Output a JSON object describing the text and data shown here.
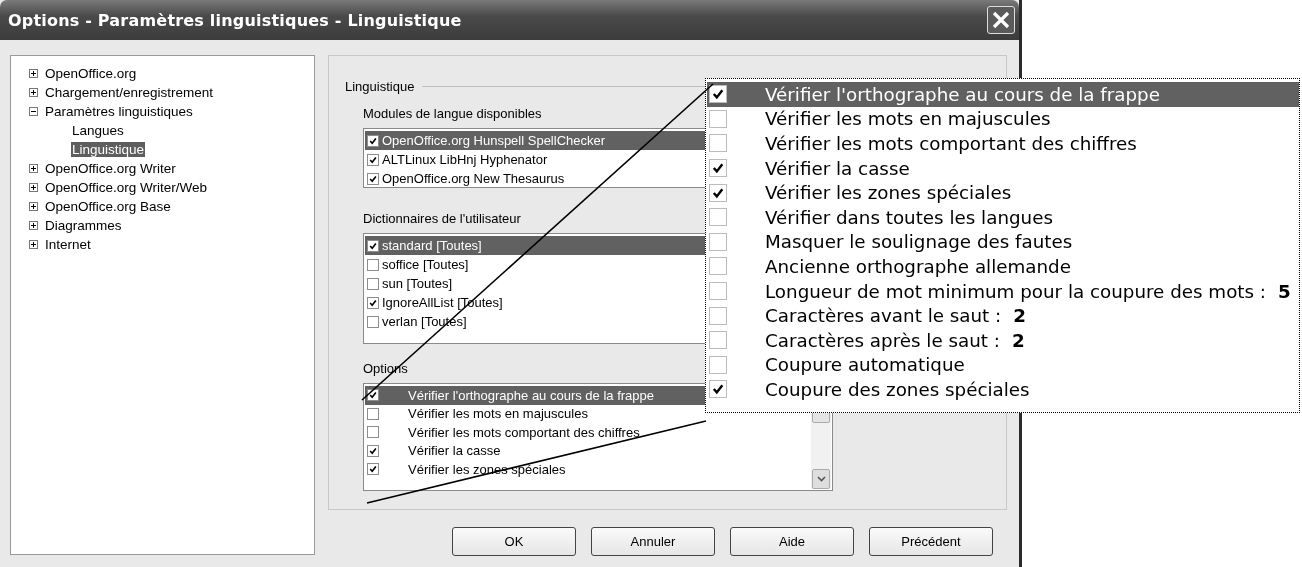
{
  "window": {
    "title": "Options - Paramètres linguistiques - Linguistique"
  },
  "tree": [
    {
      "label": "OpenOffice.org",
      "expanded": false,
      "selected": false
    },
    {
      "label": "Chargement/enregistrement",
      "expanded": false,
      "selected": false
    },
    {
      "label": "Paramètres linguistiques",
      "expanded": true,
      "selected": false,
      "children": [
        {
          "label": "Langues",
          "selected": false
        },
        {
          "label": "Linguistique",
          "selected": true
        }
      ]
    },
    {
      "label": "OpenOffice.org Writer",
      "expanded": false,
      "selected": false
    },
    {
      "label": "OpenOffice.org Writer/Web",
      "expanded": false,
      "selected": false
    },
    {
      "label": "OpenOffice.org Base",
      "expanded": false,
      "selected": false
    },
    {
      "label": "Diagrammes",
      "expanded": false,
      "selected": false
    },
    {
      "label": "Internet",
      "expanded": false,
      "selected": false
    }
  ],
  "section": {
    "title": "Linguistique"
  },
  "modules": {
    "label": "Modules de langue disponibles",
    "items": [
      {
        "label": "OpenOffice.org Hunspell SpellChecker",
        "checked": true,
        "selected": true
      },
      {
        "label": "ALTLinux LibHnj Hyphenator",
        "checked": true,
        "selected": false
      },
      {
        "label": "OpenOffice.org New Thesaurus",
        "checked": true,
        "selected": false
      }
    ]
  },
  "dictionaries": {
    "label": "Dictionnaires de l'utilisateur",
    "items": [
      {
        "label": "standard [Toutes]",
        "checked": true,
        "selected": true
      },
      {
        "label": "soffice [Toutes]",
        "checked": false,
        "selected": false
      },
      {
        "label": "sun [Toutes]",
        "checked": false,
        "selected": false
      },
      {
        "label": "IgnoreAllList [Toutes]",
        "checked": true,
        "selected": false
      },
      {
        "label": "verlan [Toutes]",
        "checked": false,
        "selected": false
      }
    ]
  },
  "options": {
    "label": "Options",
    "items": [
      {
        "label": "Vérifier l'orthographe au cours de la frappe",
        "checked": true,
        "selected": true
      },
      {
        "label": "Vérifier les mots en majuscules",
        "checked": false,
        "selected": false
      },
      {
        "label": "Vérifier les mots comportant des chiffres",
        "checked": false,
        "selected": false
      },
      {
        "label": "Vérifier la casse",
        "checked": true,
        "selected": false
      },
      {
        "label": "Vérifier les zones spéciales",
        "checked": true,
        "selected": false
      }
    ]
  },
  "zoom_callout": {
    "items": [
      {
        "label": "Vérifier l'orthographe au cours de la frappe",
        "checked": true,
        "selected": true
      },
      {
        "label": "Vérifier les mots en majuscules",
        "checked": false,
        "selected": false
      },
      {
        "label": "Vérifier les mots comportant des chiffres",
        "checked": false,
        "selected": false
      },
      {
        "label": "Vérifier la casse",
        "checked": true,
        "selected": false
      },
      {
        "label": "Vérifier les zones spéciales",
        "checked": true,
        "selected": false
      },
      {
        "label": "Vérifier dans toutes les langues",
        "checked": false,
        "selected": false
      },
      {
        "label": "Masquer le soulignage des fautes",
        "checked": false,
        "selected": false
      },
      {
        "label": "Ancienne orthographe allemande",
        "checked": false,
        "selected": false
      },
      {
        "label": "Longueur de mot minimum pour la coupure des mots :",
        "value": "5",
        "checked": false,
        "selected": false
      },
      {
        "label": "Caractères avant le saut :",
        "value": "2",
        "checked": false,
        "selected": false
      },
      {
        "label": "Caractères après le saut :",
        "value": "2",
        "checked": false,
        "selected": false
      },
      {
        "label": "Coupure automatique",
        "checked": false,
        "selected": false
      },
      {
        "label": "Coupure des zones spéciales",
        "checked": true,
        "selected": false
      }
    ]
  },
  "buttons": [
    "OK",
    "Annuler",
    "Aide",
    "Précédent"
  ]
}
